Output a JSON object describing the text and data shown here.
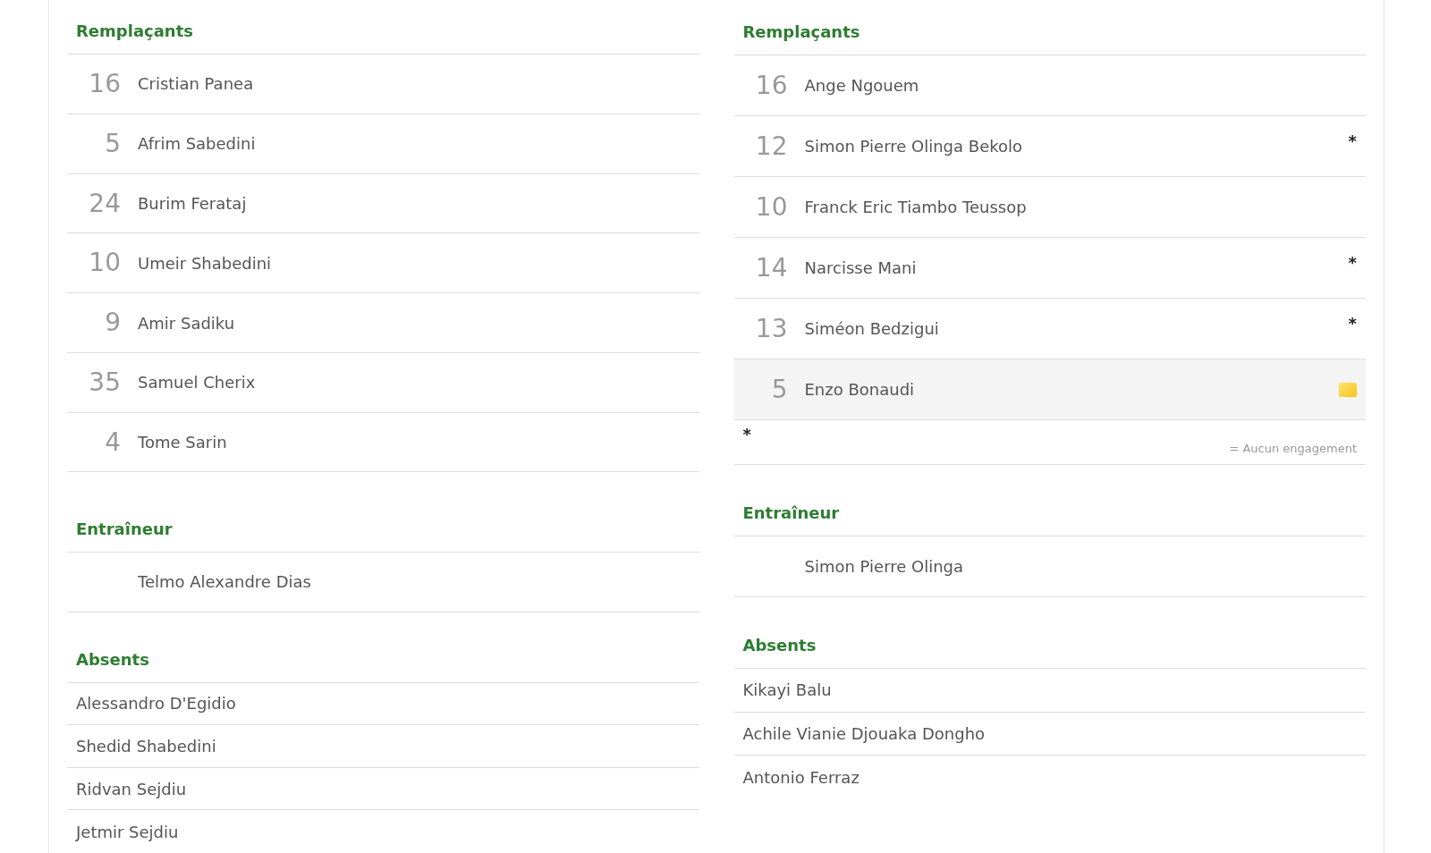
{
  "teams": [
    {
      "substitutes": {
        "title": "Remplaçants",
        "players": [
          {
            "number": "16",
            "name": "Cristian Panea",
            "yellow_card": false,
            "highlighted": false
          },
          {
            "number": "5",
            "name": "Afrim Sabedini",
            "yellow_card": false,
            "highlighted": false
          },
          {
            "number": "24",
            "name": "Burim Ferataj",
            "yellow_card": false,
            "highlighted": false
          },
          {
            "number": "10",
            "name": "Umeir Shabedini",
            "yellow_card": false,
            "highlighted": false
          },
          {
            "number": "9",
            "name": "Amir Sadiku",
            "yellow_card": false,
            "highlighted": false
          },
          {
            "number": "35",
            "name": "Samuel Cherix",
            "yellow_card": false,
            "highlighted": false
          },
          {
            "number": "4",
            "name": "Tome Sarin",
            "yellow_card": false,
            "highlighted": false
          }
        ]
      },
      "coach": {
        "title": "Entraîneur",
        "name": "Telmo Alexandre Dias"
      },
      "absents": {
        "title": "Absents",
        "players": [
          "Alessandro D'Egidio",
          "Shedid Shabedini",
          "Ridvan Sejdiu",
          "Jetmir Sejdiu"
        ]
      }
    },
    {
      "substitutes": {
        "title": "Remplaçants",
        "players": [
          {
            "number": "16",
            "name": "Ange Ngouem",
            "yellow_card": false,
            "highlighted": false
          },
          {
            "number": "12",
            "name": "Simon Pierre Olinga Bekolo",
            "note": "*",
            "yellow_card": false,
            "highlighted": false
          },
          {
            "number": "10",
            "name": "Franck Eric Tiambo Teussop",
            "yellow_card": false,
            "highlighted": false
          },
          {
            "number": "14",
            "name": "Narcisse Mani",
            "note": "*",
            "yellow_card": false,
            "highlighted": false
          },
          {
            "number": "13",
            "name": "Siméon Bedzigui",
            "note": "*",
            "yellow_card": false,
            "highlighted": false
          },
          {
            "number": "5",
            "name": "Enzo Bonaudi",
            "yellow_card": true,
            "highlighted": true
          }
        ],
        "footnote": {
          "symbol": "*",
          "text": "= Aucun engagement"
        }
      },
      "coach": {
        "title": "Entraîneur",
        "name": "Simon Pierre Olinga"
      },
      "absents": {
        "title": "Absents",
        "players": [
          "Kikayi Balu",
          "Achile Vianie Djouaka Dongho",
          "Antonio Ferraz"
        ]
      }
    }
  ]
}
